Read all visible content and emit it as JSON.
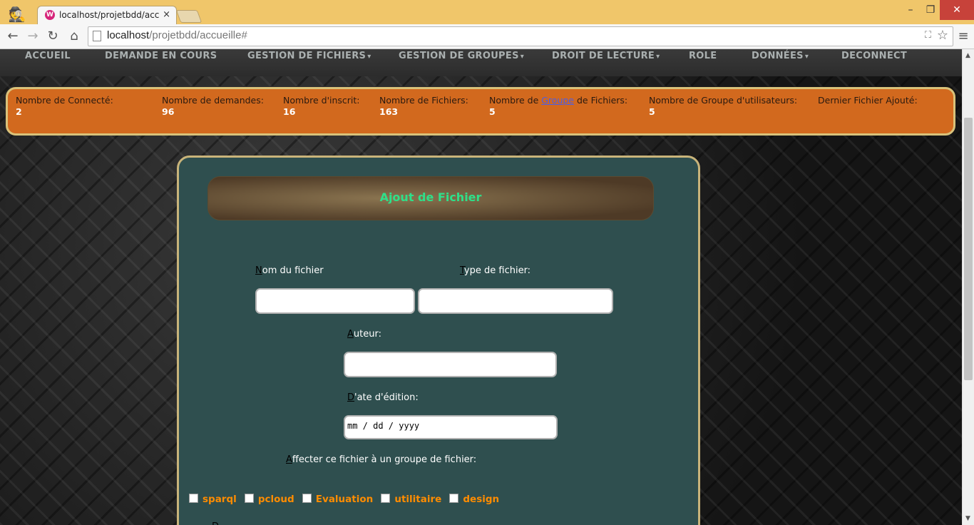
{
  "browser": {
    "tab_title": "localhost/projetbdd/accu",
    "tab_close": "×",
    "url_host": "localhost",
    "url_path": "/projetbdd/accueille#",
    "controls": {
      "minimize": "–",
      "maximize": "❐",
      "close": "✕"
    },
    "icons": {
      "back": "back-arrow-icon",
      "forward": "forward-arrow-icon",
      "reload": "reload-icon",
      "home": "home-icon",
      "star": "bookmark-star-icon",
      "menu": "menu-icon"
    }
  },
  "nav": {
    "items": [
      {
        "label": "ACCUEIL",
        "dropdown": false
      },
      {
        "label": "DEMANDE EN COURS",
        "dropdown": false
      },
      {
        "label": "GESTION DE FICHIERS",
        "dropdown": true
      },
      {
        "label": "GESTION DE GROUPES",
        "dropdown": true
      },
      {
        "label": "DROIT DE LECTURE",
        "dropdown": true
      },
      {
        "label": "ROLE",
        "dropdown": false
      },
      {
        "label": "DONNÉES",
        "dropdown": true
      },
      {
        "label": "DECONNECT",
        "dropdown": false
      }
    ],
    "caret": "▾"
  },
  "stats": [
    {
      "label": "Nombre de Connecté:",
      "value": "2"
    },
    {
      "label": "Nombre de demandes:",
      "value": "96"
    },
    {
      "label": "Nombre d'inscrit:",
      "value": "16"
    },
    {
      "label": "Nombre de Fichiers:",
      "value": "163"
    },
    {
      "label_pre": "Nombre de ",
      "label_link": "Groupe",
      "label_post": " de Fichiers:",
      "value": "5"
    },
    {
      "label": "Nombre de Groupe d'utilisateurs:",
      "value": "5"
    },
    {
      "label": "Dernier Fichier Ajouté:",
      "value": ""
    }
  ],
  "form": {
    "title": "Ajout de Fichier",
    "nom": {
      "accel": "N",
      "rest": "om du fichier",
      "value": ""
    },
    "type": {
      "accel": "T",
      "rest": "ype de fichier:",
      "value": ""
    },
    "auteur": {
      "accel": "A",
      "rest": "uteur:",
      "value": ""
    },
    "date": {
      "accel": "D",
      "rest": "'ate d'édition:",
      "placeholder": "mm / dd / yyyy"
    },
    "groupe_label": {
      "accel": "A",
      "rest": "ffecter ce fichier à un groupe de fichier:"
    },
    "groups": [
      "sparql",
      "pcloud",
      "Evaluation",
      "utilitaire",
      "design"
    ],
    "next_label_accel": "D"
  },
  "colors": {
    "titlebar": "#f0c66a",
    "stats_bg": "#d2691e",
    "panel_bg": "#2f4f4f",
    "panel_border": "#c9b47a",
    "form_title": "#2ee08a",
    "group_text": "#ff8c00"
  }
}
